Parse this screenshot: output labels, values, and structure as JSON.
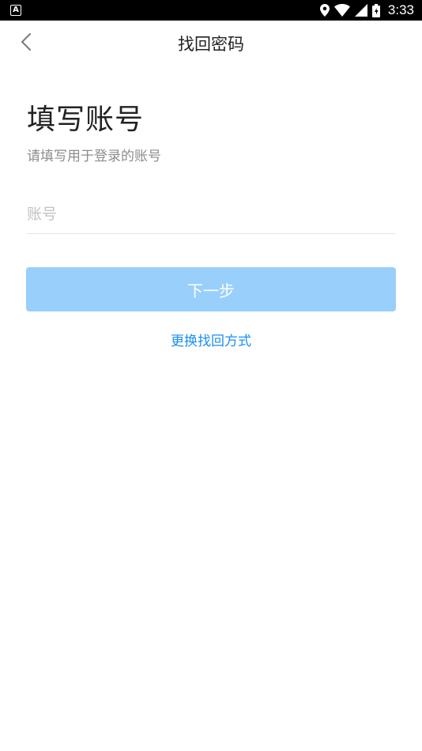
{
  "status_bar": {
    "left_icon_letter": "A",
    "time": "3:33",
    "icons": [
      "location-icon",
      "wifi-icon",
      "signal-icon",
      "battery-icon"
    ]
  },
  "nav": {
    "title": "找回密码",
    "back_icon": "chevron-left-icon"
  },
  "form": {
    "heading": "填写账号",
    "subtitle": "请填写用于登录的账号",
    "account_placeholder": "账号",
    "account_value": "",
    "next_label": "下一步",
    "switch_method_label": "更换找回方式"
  },
  "colors": {
    "button_bg": "#99cffb",
    "link": "#1a8ff2",
    "placeholder": "#c2c2c2"
  }
}
